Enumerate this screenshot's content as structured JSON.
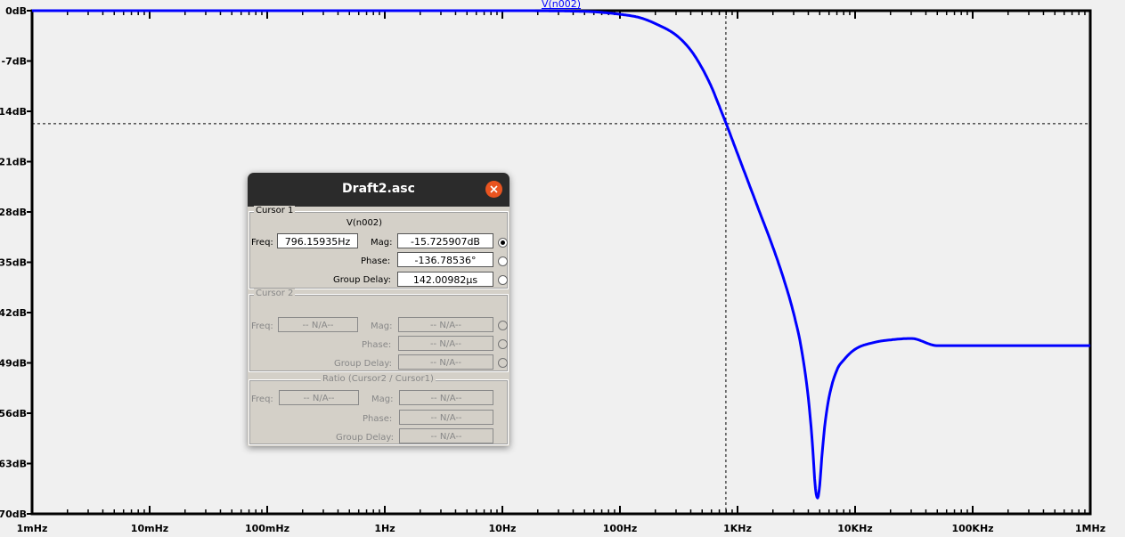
{
  "chart_data": {
    "type": "line",
    "x_scale": "log",
    "x_tick_labels": [
      "1mHz",
      "10mHz",
      "100mHz",
      "1Hz",
      "10Hz",
      "100Hz",
      "1KHz",
      "10KHz",
      "100KHz",
      "1MHz"
    ],
    "y_tick_labels": [
      "0dB",
      "-7dB",
      "-14dB",
      "-21dB",
      "-28dB",
      "-35dB",
      "-42dB",
      "-49dB",
      "-56dB",
      "-63dB",
      "-70dB"
    ],
    "xlim_hz": [
      0.001,
      1000000
    ],
    "ylim_db": [
      -70,
      0
    ],
    "series": [
      {
        "name": "V(n002)",
        "color": "#0000ff",
        "x_hz": [
          0.001,
          10,
          50,
          100,
          150,
          200,
          300,
          400,
          500,
          600,
          700,
          800,
          1000,
          1500,
          2000,
          2500,
          3000,
          3500,
          4000,
          4300,
          4600,
          4800,
          5000,
          5200,
          5500,
          6000,
          7000,
          8000,
          10000,
          15000,
          20000,
          30000,
          50000,
          100000,
          1000000
        ],
        "y_db": [
          0,
          0,
          -0.1,
          -0.5,
          -1.0,
          -1.8,
          -3.4,
          -5.5,
          -8.0,
          -10.6,
          -13.3,
          -15.7,
          -19.9,
          -27.5,
          -32.9,
          -37.6,
          -42.1,
          -47.1,
          -53.9,
          -59.5,
          -66.5,
          -67.8,
          -66.0,
          -62.3,
          -58.0,
          -53.8,
          -50.0,
          -48.6,
          -47.1,
          -46.1,
          -45.8,
          -45.6,
          -46.6,
          -46.6,
          -46.6
        ]
      }
    ],
    "cursor": {
      "freq_hz": 796.15935,
      "mag_db": -15.725907
    },
    "grid": false
  },
  "dialog": {
    "title": "Draft2.asc",
    "close_icon": "close-icon",
    "cursor1": {
      "group_label": "Cursor 1",
      "trace": "V(n002)",
      "freq_label": "Freq:",
      "freq_value": "796.15935Hz",
      "mag_label": "Mag:",
      "mag_value": "-15.725907dB",
      "phase_label": "Phase:",
      "phase_value": "-136.78536°",
      "gd_label": "Group Delay:",
      "gd_value": "142.00982µs"
    },
    "cursor2": {
      "group_label": "Cursor 2",
      "freq_label": "Freq:",
      "freq_value": "-- N/A--",
      "mag_label": "Mag:",
      "mag_value": "-- N/A--",
      "phase_label": "Phase:",
      "phase_value": "-- N/A--",
      "gd_label": "Group Delay:",
      "gd_value": "-- N/A--"
    },
    "ratio": {
      "group_label": "Ratio (Cursor2 / Cursor1)",
      "freq_label": "Freq:",
      "freq_value": "-- N/A--",
      "mag_label": "Mag:",
      "mag_value": "-- N/A--",
      "phase_label": "Phase:",
      "phase_value": "-- N/A--",
      "gd_label": "Group Delay:",
      "gd_value": "-- N/A--"
    }
  }
}
